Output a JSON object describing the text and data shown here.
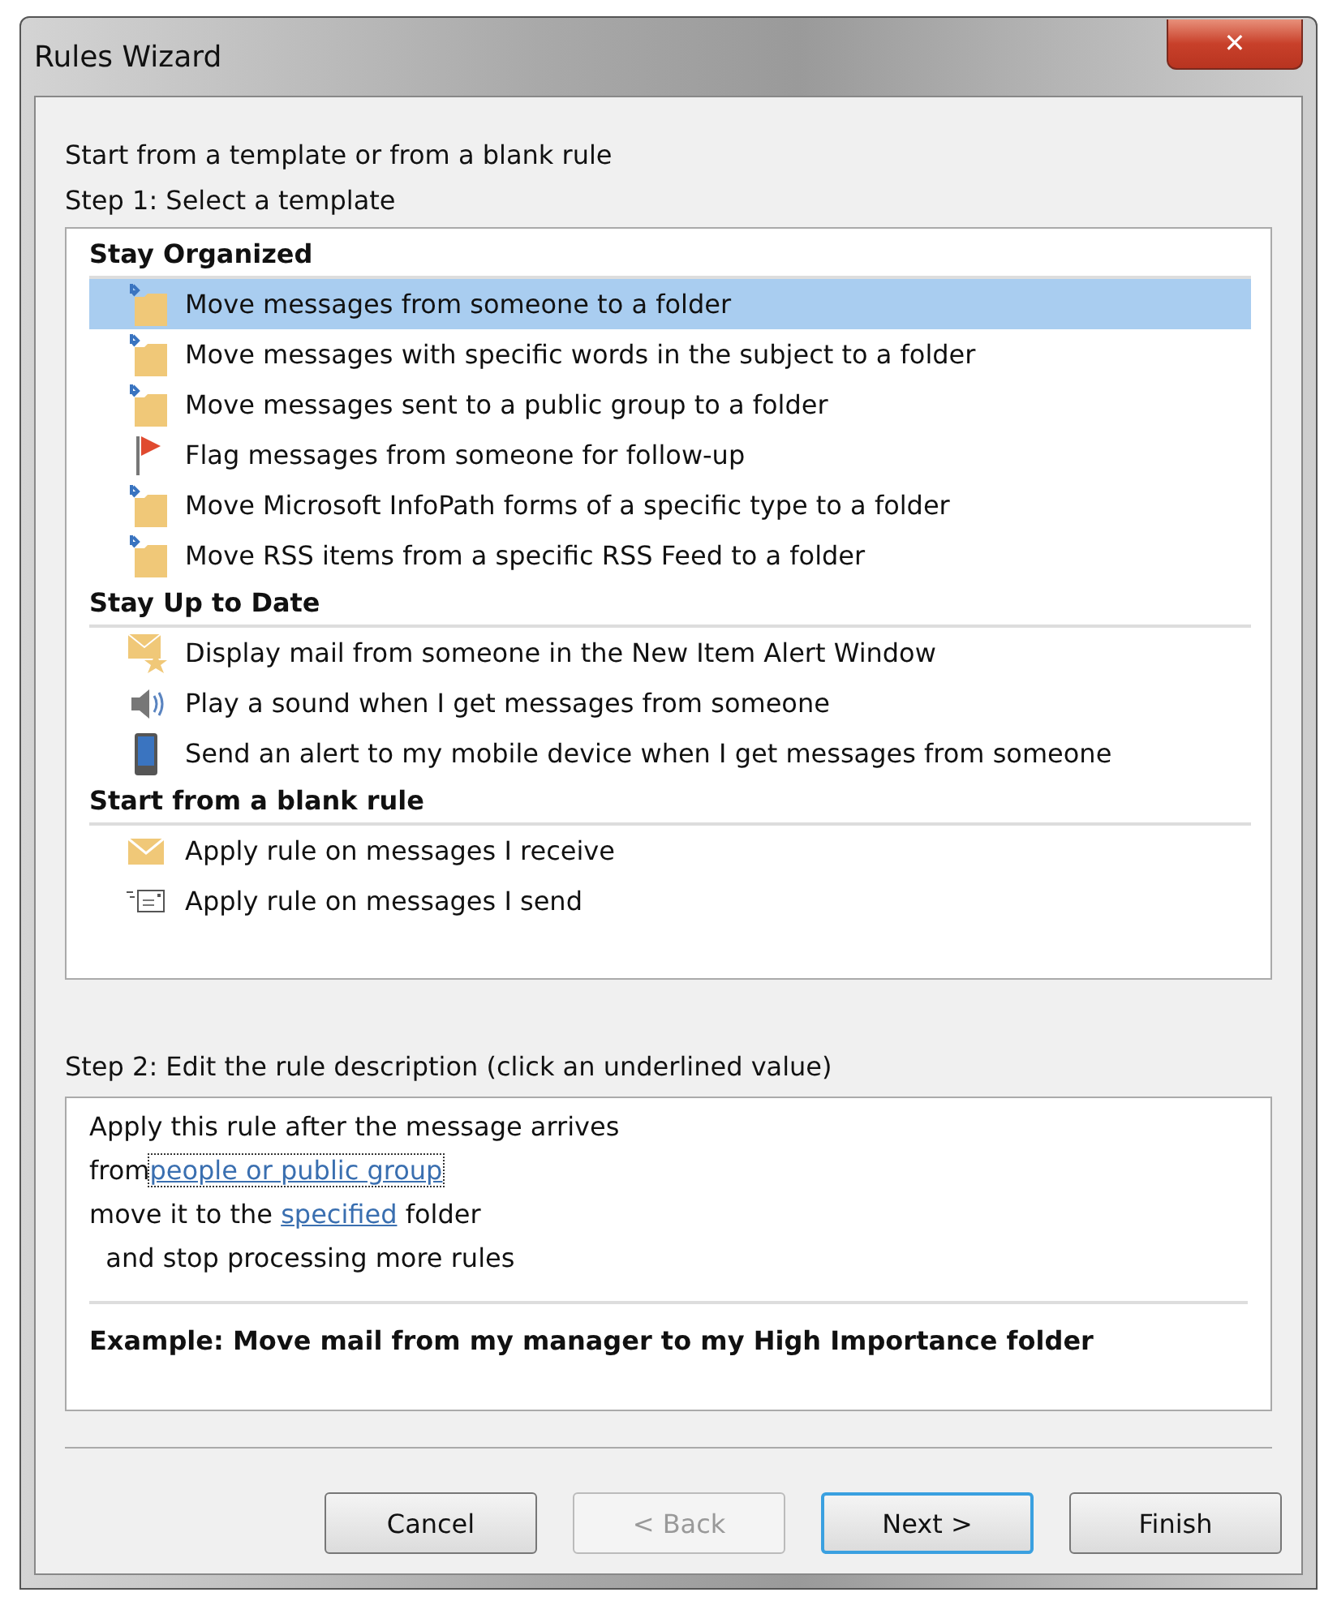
{
  "window": {
    "title": "Rules Wizard",
    "close": "✕"
  },
  "intro": "Start from a template or from a blank rule",
  "step1": "Step 1: Select a template",
  "groups": [
    {
      "title": "Stay Organized",
      "items": [
        {
          "label": "Move messages from someone to a folder",
          "kind": "folder-move",
          "selected": true
        },
        {
          "label": "Move messages with specific words in the subject to a folder",
          "kind": "folder-move",
          "selected": false
        },
        {
          "label": "Move messages sent to a public group to a folder",
          "kind": "folder-move",
          "selected": false
        },
        {
          "label": "Flag messages from someone for follow-up",
          "kind": "flag",
          "selected": false
        },
        {
          "label": "Move Microsoft InfoPath forms of a specific type to a folder",
          "kind": "folder-move",
          "selected": false
        },
        {
          "label": "Move RSS items from a specific RSS Feed to a folder",
          "kind": "folder-move",
          "selected": false
        }
      ]
    },
    {
      "title": "Stay Up to Date",
      "items": [
        {
          "label": "Display mail from someone in the New Item Alert Window",
          "kind": "mail-star",
          "selected": false
        },
        {
          "label": "Play a sound when I get messages from someone",
          "kind": "speaker",
          "selected": false
        },
        {
          "label": "Send an alert to my mobile device when I get messages from someone",
          "kind": "phone",
          "selected": false
        }
      ]
    },
    {
      "title": "Start from a blank rule",
      "items": [
        {
          "label": "Apply rule on messages I receive",
          "kind": "envelope",
          "selected": false
        },
        {
          "label": "Apply rule on messages I send",
          "kind": "sent-mail",
          "selected": false
        }
      ]
    }
  ],
  "step2": "Step 2: Edit the rule description (click an underlined value)",
  "description": [
    [
      {
        "text": "Apply this rule after the message arrives",
        "link": false
      }
    ],
    [
      {
        "text": "from",
        "link": false
      },
      {
        "text": "people or public group",
        "link": true,
        "focused": true
      }
    ],
    [
      {
        "text": "move it to the ",
        "link": false
      },
      {
        "text": "specified",
        "link": true,
        "focused": false
      },
      {
        "text": " folder",
        "link": false
      }
    ],
    [
      {
        "text": "  and stop processing more rules",
        "link": false
      }
    ]
  ],
  "example": "Example: Move mail from my manager to my High Importance folder",
  "buttons": [
    {
      "label": "Cancel",
      "disabled": false,
      "default": false
    },
    {
      "label": "< Back",
      "disabled": true,
      "default": false
    },
    {
      "label": "Next >",
      "disabled": false,
      "default": true
    },
    {
      "label": "Finish",
      "disabled": false,
      "default": false
    }
  ]
}
